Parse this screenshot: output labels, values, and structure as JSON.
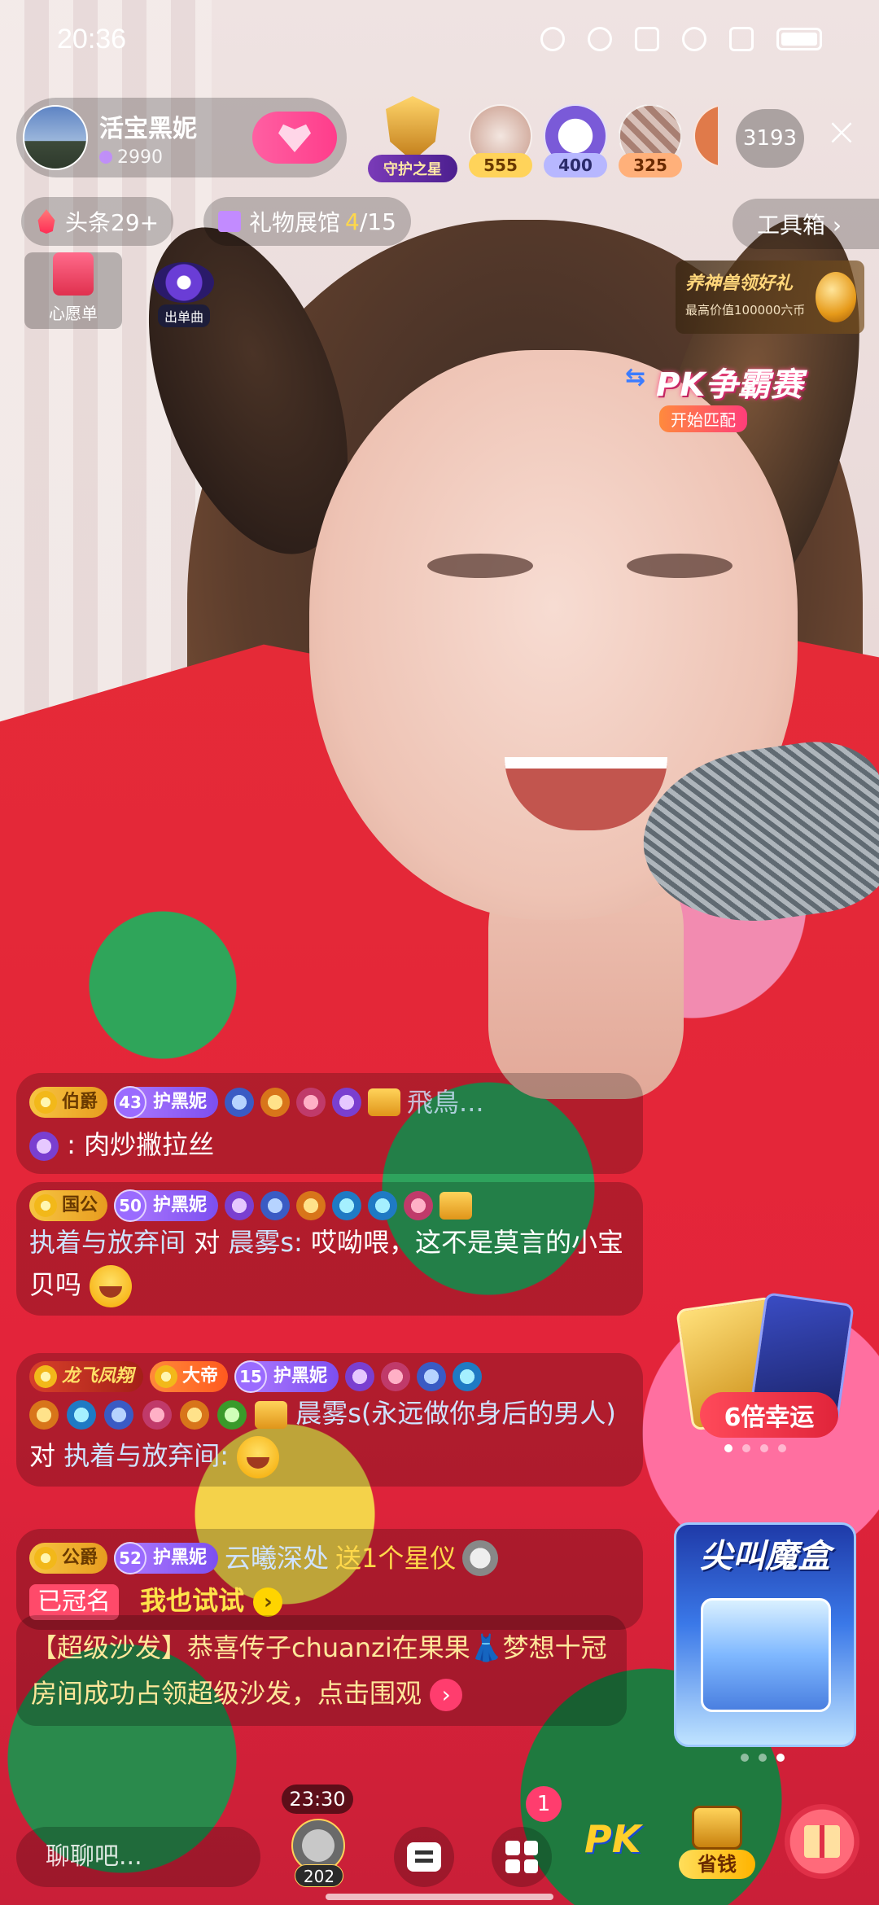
{
  "status_bar": {
    "time": "20:36"
  },
  "host": {
    "name": "活宝黑妮",
    "score": "2990"
  },
  "guard_star": {
    "label": "守护之星"
  },
  "top_ranks": [
    {
      "value": "555",
      "color": "#ffd35a"
    },
    {
      "value": "400",
      "color": "#b7b7ff"
    },
    {
      "value": "325",
      "color": "#ffb07a"
    }
  ],
  "viewer_count": "3193",
  "headline_pill": {
    "label": "头条29+"
  },
  "gift_hall": {
    "label": "礼物展馆",
    "progress": "4",
    "total": "/15"
  },
  "toolbox": {
    "label": "工具箱 ›"
  },
  "wishlist": {
    "label": "心愿单"
  },
  "song_icon": {
    "label": "出单曲"
  },
  "promo": {
    "title": "养神兽领好礼",
    "subtitle": "最高价值100000六币"
  },
  "pk_banner": {
    "title": "PK争霸赛",
    "subtitle": "开始匹配"
  },
  "chat": [
    {
      "level": "伯爵",
      "fan_num": "43",
      "fan_label": "护黑妮",
      "user": "飛鳥...",
      "text": ":  肉炒撇拉丝"
    },
    {
      "level": "国公",
      "fan_num": "50",
      "fan_label": "护黑妮",
      "user": "执着与放弃间",
      "to": " 对 ",
      "target": "晨雾s:",
      "text": " 哎呦喂，这不是莫言的小宝贝吗"
    },
    {
      "dragon": "龙飞凤翔",
      "level": "大帝",
      "fan_num": "15",
      "fan_label": "护黑妮",
      "user": "晨雾s(永远做你身后的男人)",
      "to": " 对 ",
      "target": "执着与放弃间:",
      "text": ""
    },
    {
      "level": "公爵",
      "fan_num": "52",
      "fan_label": "护黑妮",
      "user": "云曦深处",
      "gift_text": " 送1个星仪",
      "crowned": "已冠名",
      "try": "我也试试"
    }
  ],
  "system_msg": "【超级沙发】恭喜传子chuanzi在果果👗梦想十冠房间成功占领超级沙发，点击围观",
  "lucky": {
    "label": "6倍幸运"
  },
  "magic_box": {
    "title": "尖叫魔盒"
  },
  "bottom": {
    "input_placeholder": "聊聊吧...",
    "timer": "23:30",
    "avatar_count": "202",
    "apps_badge": "1",
    "pk_label": "PK",
    "save_label": "省钱"
  }
}
